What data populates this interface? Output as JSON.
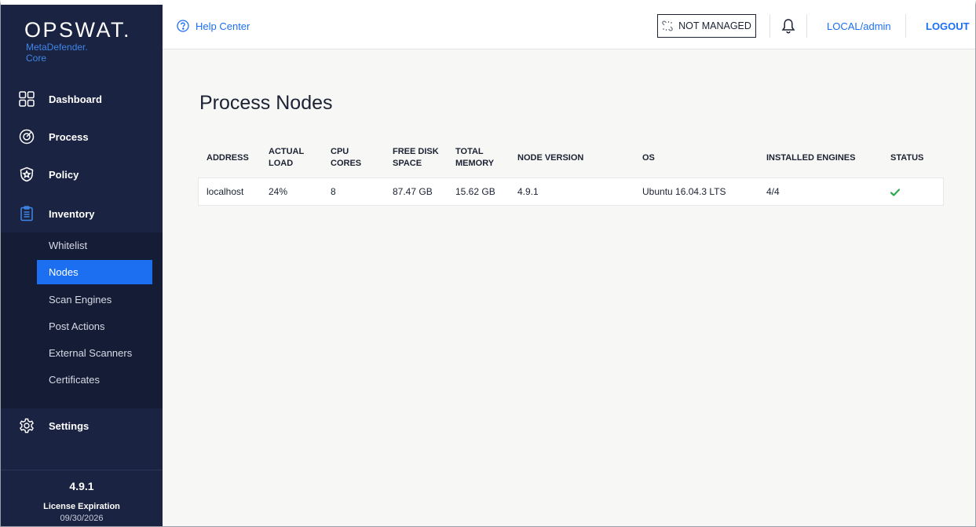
{
  "brand": {
    "name": "OPSWAT.",
    "product_line1": "MetaDefender.",
    "product_line2": "Core"
  },
  "sidebar": {
    "items": [
      {
        "label": "Dashboard",
        "icon": "dashboard-icon"
      },
      {
        "label": "Process",
        "icon": "process-icon"
      },
      {
        "label": "Policy",
        "icon": "policy-icon"
      },
      {
        "label": "Inventory",
        "icon": "inventory-icon"
      },
      {
        "label": "Settings",
        "icon": "settings-icon"
      }
    ],
    "inventory_sub": [
      {
        "label": "Whitelist"
      },
      {
        "label": "Nodes",
        "active": true
      },
      {
        "label": "Scan Engines"
      },
      {
        "label": "Post Actions"
      },
      {
        "label": "External Scanners"
      },
      {
        "label": "Certificates"
      }
    ],
    "version": "4.9.1",
    "license_label": "License Expiration",
    "license_date": "09/30/2026"
  },
  "header": {
    "help": "Help Center",
    "not_managed": "NOT MANAGED",
    "user": "LOCAL/admin",
    "logout": "LOGOUT"
  },
  "page": {
    "title": "Process Nodes"
  },
  "table": {
    "headers": {
      "address": "ADDRESS",
      "load1": "ACTUAL",
      "load2": "LOAD",
      "cpu1": "CPU",
      "cpu2": "CORES",
      "disk1": "FREE DISK",
      "disk2": "SPACE",
      "mem1": "TOTAL",
      "mem2": "MEMORY",
      "node_version": "NODE VERSION",
      "os": "OS",
      "engines": "INSTALLED ENGINES",
      "status": "STATUS"
    },
    "rows": [
      {
        "address": "localhost",
        "load": "24%",
        "cpu": "8",
        "disk": "87.47 GB",
        "memory": "15.62 GB",
        "node_version": "4.9.1",
        "os": "Ubuntu 16.04.3 LTS",
        "engines": "4/4",
        "status": "ok"
      }
    ]
  },
  "colors": {
    "sidebar_bg": "#1b2342",
    "accent": "#1d6ff2",
    "status_ok": "#2fa84f"
  }
}
